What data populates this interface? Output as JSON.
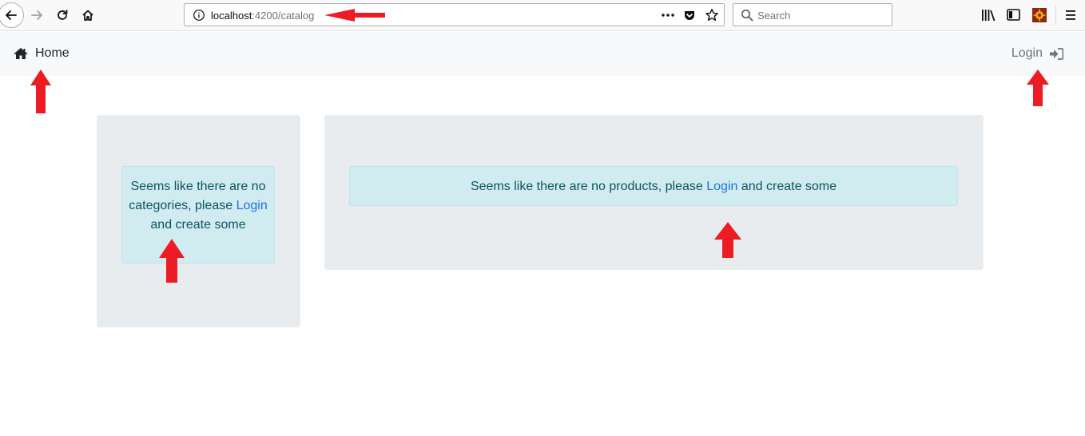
{
  "browser": {
    "url_host": "localhost",
    "url_path": ":4200/catalog",
    "search_placeholder": "Search"
  },
  "navbar": {
    "home_label": "Home",
    "login_label": "Login"
  },
  "categories_alert": {
    "text_before": "Seems like there are no categories, please ",
    "link": "Login",
    "text_after": " and create some"
  },
  "products_alert": {
    "text_before": "Seems like there are no products, please ",
    "link": "Login",
    "text_after": " and create some"
  },
  "colors": {
    "annotation_arrow": "#ed1c24",
    "alert_bg": "#d1ecf1",
    "alert_text": "#0c5460",
    "link": "#1a73e8",
    "panel_bg": "#e9ecef",
    "navbar_bg": "#f8f9fa"
  }
}
